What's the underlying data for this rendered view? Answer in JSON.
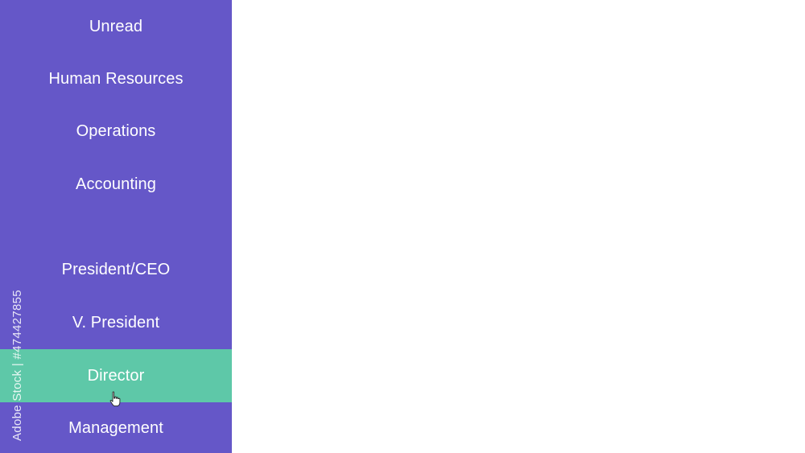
{
  "sidebar": {
    "bg_color": "#6557c8",
    "active_color": "#5ec8a8",
    "items": [
      {
        "label": "Unread"
      },
      {
        "label": "Human Resources"
      },
      {
        "label": "Operations"
      },
      {
        "label": "Accounting"
      },
      {
        "label": "President/CEO"
      },
      {
        "label": "V. President"
      },
      {
        "label": "Director",
        "active": true
      },
      {
        "label": "Management"
      }
    ]
  },
  "watermark": {
    "text": "Adobe Stock | #474427855"
  },
  "cursor": {
    "icon": "hand-pointer-icon"
  }
}
